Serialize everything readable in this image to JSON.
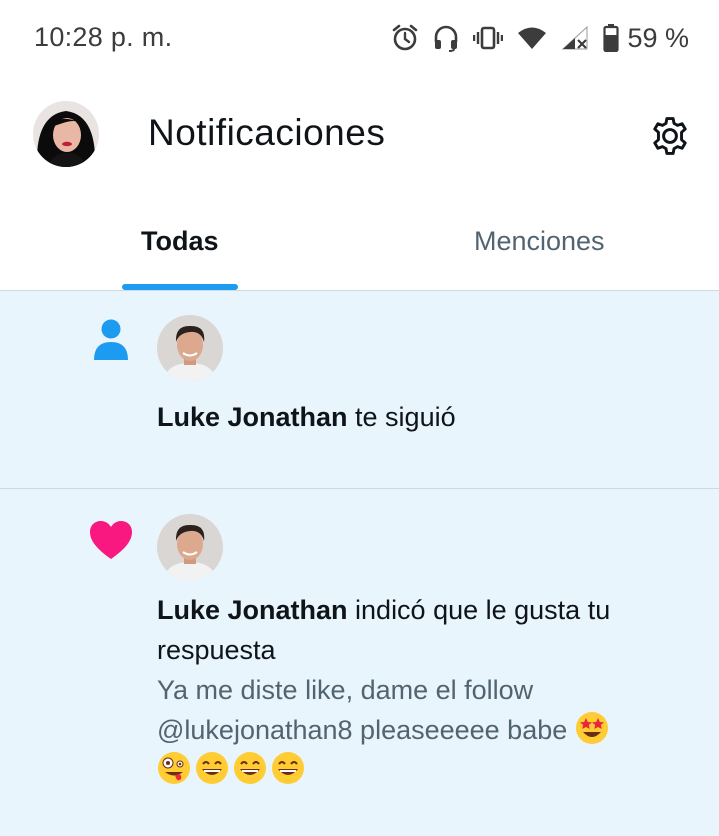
{
  "status_bar": {
    "time": "10:28 p. m.",
    "battery_percent": "59 %",
    "icons": [
      "alarm-icon",
      "headset-icon",
      "vibrate-icon",
      "wifi-icon",
      "signal-icon",
      "battery-icon"
    ]
  },
  "header": {
    "title": "Notificaciones",
    "avatar_icon": "profile-avatar",
    "settings_icon": "gear-icon"
  },
  "tabs": [
    {
      "label": "Todas",
      "active": true
    },
    {
      "label": "Menciones",
      "active": false
    }
  ],
  "notifications": [
    {
      "type_icon": "person-icon",
      "user": "Luke Jonathan",
      "action": " te siguió"
    },
    {
      "type_icon": "heart-icon",
      "user": "Luke Jonathan",
      "action": " indicó que le gusta tu respuesta",
      "quoted_text": "Ya me diste like, dame el follow @lukejonathan8  pleaseeeee babe",
      "emojis": [
        "star-struck-emoji",
        "zany-face-emoji",
        "grinning-emoji",
        "grinning-emoji",
        "grinning-emoji"
      ]
    }
  ],
  "colors": {
    "accent": "#1d9bf0",
    "like": "#f91880",
    "unread_bg": "#e8f5fd",
    "secondary_text": "#536471"
  }
}
